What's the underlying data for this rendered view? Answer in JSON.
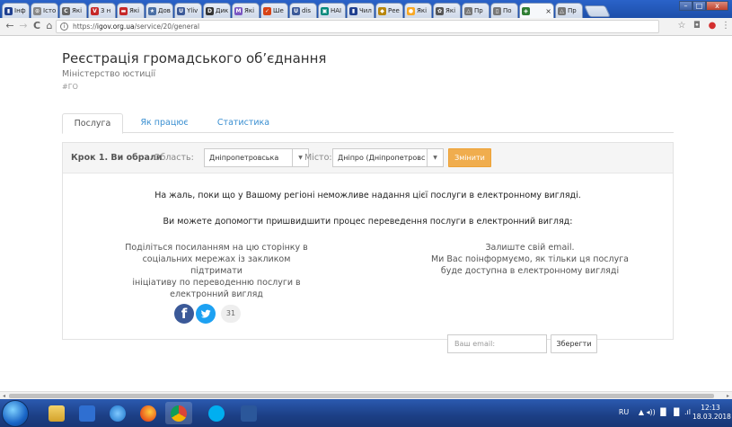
{
  "browser": {
    "tabs": [
      {
        "label": "Інф",
        "favicon_color": "#1f3f8f",
        "favicon_glyph": "▮"
      },
      {
        "label": "Істо",
        "favicon_color": "#888888",
        "favicon_glyph": "⊙"
      },
      {
        "label": "Які",
        "favicon_color": "#666666",
        "favicon_glyph": "C"
      },
      {
        "label": "3 н",
        "favicon_color": "#c62828",
        "favicon_glyph": "V"
      },
      {
        "label": "Які",
        "favicon_color": "#c62828",
        "favicon_glyph": "▬"
      },
      {
        "label": "Дов",
        "favicon_color": "#4a6fa5",
        "favicon_glyph": "★"
      },
      {
        "label": "Yliv",
        "favicon_color": "#3b5998",
        "favicon_glyph": "U"
      },
      {
        "label": "Дик",
        "favicon_color": "#333333",
        "favicon_glyph": "D"
      },
      {
        "label": "Які",
        "favicon_color": "#7b57c2",
        "favicon_glyph": "M"
      },
      {
        "label": "Ше",
        "favicon_color": "#d84315",
        "favicon_glyph": "✓"
      },
      {
        "label": "dis",
        "favicon_color": "#3b5998",
        "favicon_glyph": "U"
      },
      {
        "label": "HAI",
        "favicon_color": "#00897b",
        "favicon_glyph": "▣"
      },
      {
        "label": "Чил",
        "favicon_color": "#1f3f8f",
        "favicon_glyph": "▮"
      },
      {
        "label": "Рее",
        "favicon_color": "#b8860b",
        "favicon_glyph": "◆"
      },
      {
        "label": "Які",
        "favicon_color": "#f9a825",
        "favicon_glyph": "●"
      },
      {
        "label": "Які",
        "favicon_color": "#555555",
        "favicon_glyph": "✿"
      },
      {
        "label": "Пр",
        "favicon_color": "#777777",
        "favicon_glyph": "△"
      },
      {
        "label": "По",
        "favicon_color": "#777777",
        "favicon_glyph": "▯"
      },
      {
        "label": "",
        "favicon_color": "#2e7d32",
        "favicon_glyph": "◈",
        "active": true
      },
      {
        "label": "Пр",
        "favicon_color": "#777777",
        "favicon_glyph": "△"
      }
    ],
    "active_tab_close": "×",
    "window_buttons": {
      "minimize": "–",
      "maximize": "□",
      "close": "x"
    },
    "nav": {
      "back": "←",
      "forward": "→",
      "reload": "C",
      "home": "⌂"
    },
    "url": {
      "info": "i",
      "scheme": "https://",
      "host": "igov.org.ua",
      "path": "/service/20/general"
    },
    "toolbar_icons": {
      "star": "☆",
      "ext1": "◘",
      "ext2": "●",
      "menu": "⋮"
    }
  },
  "page": {
    "title": "Реєстрація громадського об’єднання",
    "subtitle": "Міністерство юстиції",
    "hashtag": "#ГО",
    "tabs": [
      {
        "label": "Послуга",
        "active": true
      },
      {
        "label": "Як працює",
        "active": false
      },
      {
        "label": "Статистика",
        "active": false
      }
    ],
    "step": {
      "label": "Крок 1. Ви обрали",
      "region_label": "Область:",
      "region_value": "Дніпропетровська",
      "city_label": "Місто:",
      "city_value": "Дніпро (Дніпропетровс",
      "change_button": "Змінити"
    },
    "message_unavailable": "На жаль, поки що у Вашому регіоні неможливе надання цієї послуги в електронному вигляді.",
    "message_help": "Ви можете допомогти пришвидшити процес переведення послуги в електронний вигляд:",
    "share": {
      "text_lines": [
        "Поділіться посиланням на цю сторінку в",
        "соціальних мережах із закликом підтримати",
        "ініціативу по переводенню послуги в",
        "електронний вигляд"
      ],
      "facebook_glyph": "f",
      "count": "31"
    },
    "notify": {
      "text_lines": [
        "Залиште свій email.",
        "Ми Вас поінформуємо, як тільки ця послуга",
        "буде доступна в електронному вигляді"
      ],
      "email_placeholder": "Ваш email:",
      "save_button": "Зберегти"
    }
  },
  "taskbar": {
    "language": "RU",
    "tray_icons": "▲ ◂)) ▐▌ ▐▌ .ıl",
    "time": "12:13",
    "date": "18.03.2018"
  },
  "colors": {
    "link_blue": "#3a8fd1",
    "warning_orange": "#f0ad4e",
    "facebook": "#3b5998",
    "twitter": "#1da1f2"
  }
}
